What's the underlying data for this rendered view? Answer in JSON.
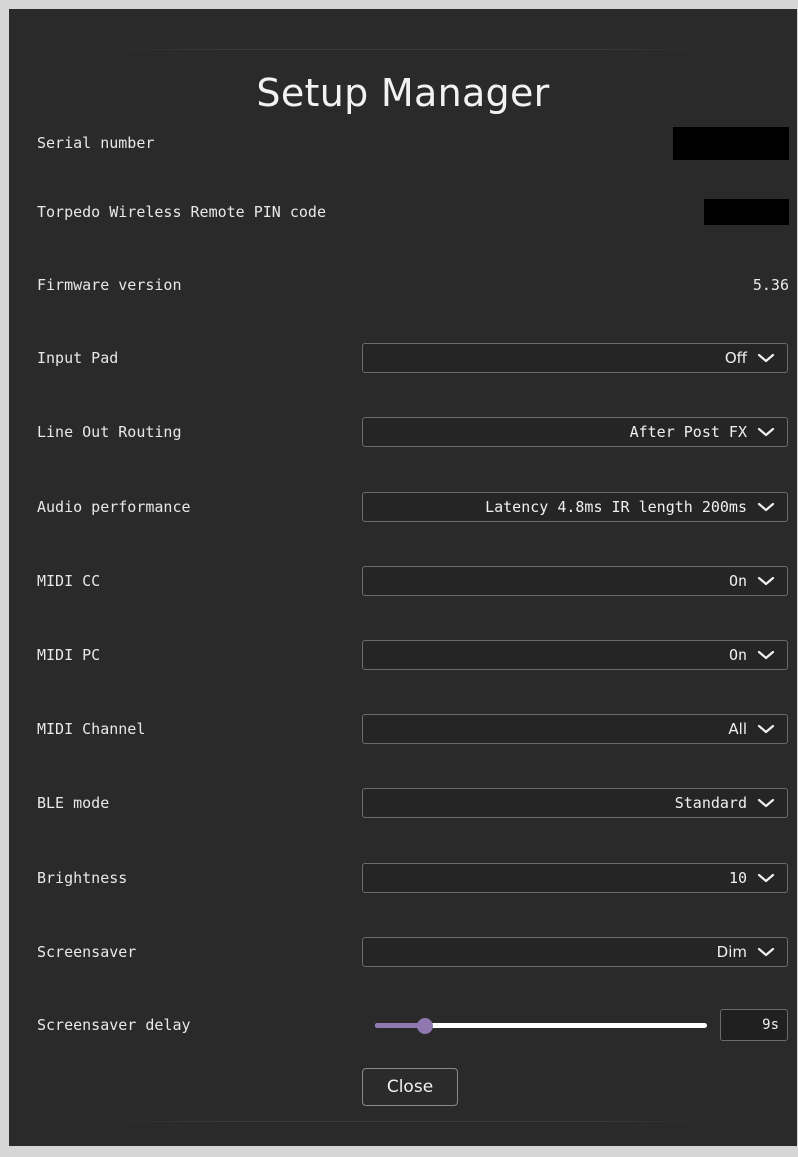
{
  "title": "Setup Manager",
  "info": {
    "serial_label": "Serial number",
    "pin_label": "Torpedo Wireless Remote PIN code",
    "firmware_label": "Firmware version",
    "firmware_value": "5.36"
  },
  "settings": [
    {
      "label": "Input Pad",
      "value": "Off"
    },
    {
      "label": "Line Out Routing",
      "value": "After Post FX"
    },
    {
      "label": "Audio performance",
      "value": "Latency 4.8ms IR length 200ms"
    },
    {
      "label": "MIDI CC",
      "value": "On"
    },
    {
      "label": "MIDI PC",
      "value": "On"
    },
    {
      "label": "MIDI Channel",
      "value": "All"
    },
    {
      "label": "BLE mode",
      "value": "Standard"
    },
    {
      "label": "Brightness",
      "value": "10"
    },
    {
      "label": "Screensaver",
      "value": "Dim"
    }
  ],
  "screensaver_delay": {
    "label": "Screensaver delay",
    "value": "9s",
    "slider_fraction": 0.15
  },
  "close_label": "Close",
  "icons": {
    "dropdown": "chevron-down-icon"
  },
  "colors": {
    "background": "#2a2a2a",
    "accent": "#8f78b0",
    "text": "#ececec"
  }
}
